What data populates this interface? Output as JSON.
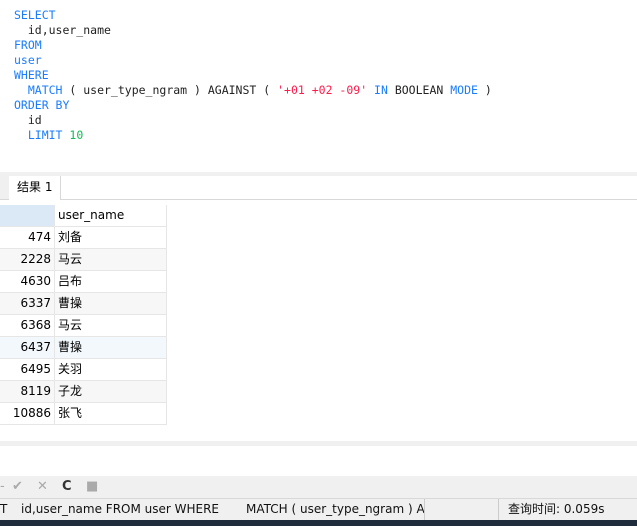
{
  "editor": {
    "lines": [
      [
        {
          "t": "SELECT",
          "c": "kw"
        }
      ],
      [
        {
          "t": "  id,user_name",
          "c": ""
        }
      ],
      [
        {
          "t": "FROM",
          "c": "kw"
        }
      ],
      [
        {
          "t": "user",
          "c": "kw"
        }
      ],
      [
        {
          "t": "WHERE",
          "c": "kw"
        }
      ],
      [
        {
          "t": "  MATCH",
          "c": "kw"
        },
        {
          "t": " ( user_type_ngram ) AGAINST ( ",
          "c": ""
        },
        {
          "t": "'+01 +02 -09'",
          "c": "str"
        },
        {
          "t": " IN",
          "c": "kw"
        },
        {
          "t": " BOOLEAN ",
          "c": ""
        },
        {
          "t": "MODE",
          "c": "kw"
        },
        {
          "t": " )",
          "c": ""
        }
      ],
      [
        {
          "t": "ORDER BY",
          "c": "kw"
        }
      ],
      [
        {
          "t": "  id",
          "c": ""
        }
      ],
      [
        {
          "t": "  LIMIT",
          "c": "kw"
        },
        {
          "t": " ",
          "c": ""
        },
        {
          "t": "10",
          "c": "num"
        }
      ]
    ]
  },
  "result_tab": {
    "label": "结果 1"
  },
  "grid": {
    "columns": [
      "",
      "user_name"
    ],
    "rows": [
      [
        "474",
        "刘备"
      ],
      [
        "2228",
        "马云"
      ],
      [
        "4630",
        "吕布"
      ],
      [
        "6337",
        "曹操"
      ],
      [
        "6368",
        "马云"
      ],
      [
        "6437",
        "曹操"
      ],
      [
        "6495",
        "关羽"
      ],
      [
        "8119",
        "子龙"
      ],
      [
        "10886",
        "张飞"
      ]
    ]
  },
  "toolbar": {
    "icons": [
      "minus-icon",
      "check-icon",
      "close-icon",
      "refresh-icon",
      "stop-icon"
    ],
    "glyphs": [
      "-",
      "✔",
      "✕",
      "C",
      "■"
    ]
  },
  "status": {
    "query_fragment_1": "T",
    "query_fragment_2": "id,user_name FROM user WHERE",
    "query_fragment_3": "MATCH ( user_type_ngram ) A",
    "query_time": "查询时间: 0.059s"
  }
}
